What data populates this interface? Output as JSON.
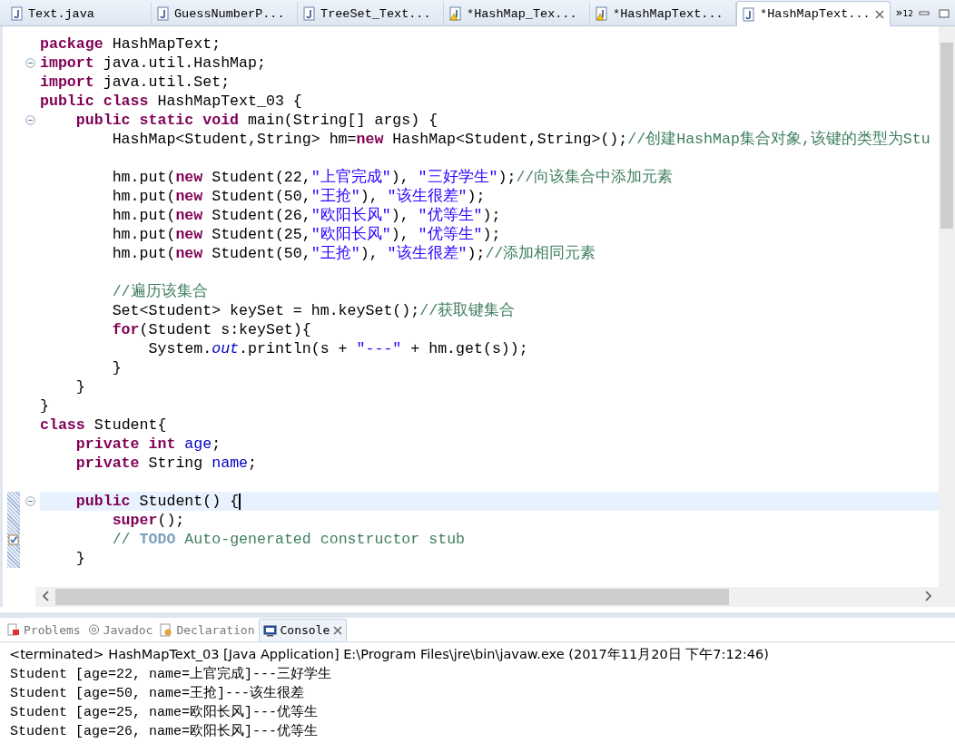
{
  "editor_tabs": [
    {
      "label": "Text.java",
      "selected": false,
      "warning": false
    },
    {
      "label": "GuessNumberP...",
      "selected": false,
      "warning": false
    },
    {
      "label": "TreeSet_Text...",
      "selected": false,
      "warning": false
    },
    {
      "label": "*HashMap_Tex...",
      "selected": false,
      "warning": true
    },
    {
      "label": "*HashMapText...",
      "selected": false,
      "warning": true
    },
    {
      "label": "*HashMapText...",
      "selected": true,
      "warning": false
    }
  ],
  "overflow_tabs": {
    "label": "»",
    "count": "12"
  },
  "code_lines": [
    {
      "kind": "code",
      "tokens": [
        {
          "kind": "kw",
          "text": "package"
        },
        {
          "kind": "plain",
          "text": " HashMapText;"
        }
      ]
    },
    {
      "kind": "code",
      "folding": true,
      "tokens": [
        {
          "kind": "kw",
          "text": "import"
        },
        {
          "kind": "plain",
          "text": " java.util.HashMap;"
        }
      ]
    },
    {
      "kind": "code",
      "tokens": [
        {
          "kind": "kw",
          "text": "import"
        },
        {
          "kind": "plain",
          "text": " java.util.Set;"
        }
      ]
    },
    {
      "kind": "code",
      "tokens": [
        {
          "kind": "kw",
          "text": "public class"
        },
        {
          "kind": "plain",
          "text": " HashMapText_03 {"
        }
      ]
    },
    {
      "kind": "code",
      "folding": true,
      "tokens": [
        {
          "kind": "kw",
          "text": "    public static void"
        },
        {
          "kind": "plain",
          "text": " main(String[] args) {"
        }
      ]
    },
    {
      "kind": "code",
      "tokens": [
        {
          "kind": "plain",
          "text": "        HashMap<Student,String> hm="
        },
        {
          "kind": "kw",
          "text": "new"
        },
        {
          "kind": "plain",
          "text": " HashMap<Student,String>();"
        },
        {
          "kind": "comment",
          "text": "//创建HashMap集合对象,该键的类型为Stu"
        }
      ]
    },
    {
      "kind": "blank"
    },
    {
      "kind": "code",
      "tokens": [
        {
          "kind": "plain",
          "text": "        hm.put("
        },
        {
          "kind": "kw",
          "text": "new"
        },
        {
          "kind": "plain",
          "text": " Student(22,"
        },
        {
          "kind": "str",
          "text": "\"上官完成\""
        },
        {
          "kind": "plain",
          "text": "), "
        },
        {
          "kind": "str",
          "text": "\"三好学生\""
        },
        {
          "kind": "plain",
          "text": ");"
        },
        {
          "kind": "comment",
          "text": "//向该集合中添加元素"
        }
      ]
    },
    {
      "kind": "code",
      "tokens": [
        {
          "kind": "plain",
          "text": "        hm.put("
        },
        {
          "kind": "kw",
          "text": "new"
        },
        {
          "kind": "plain",
          "text": " Student(50,"
        },
        {
          "kind": "str",
          "text": "\"王抢\""
        },
        {
          "kind": "plain",
          "text": "), "
        },
        {
          "kind": "str",
          "text": "\"该生很差\""
        },
        {
          "kind": "plain",
          "text": ");"
        }
      ]
    },
    {
      "kind": "code",
      "tokens": [
        {
          "kind": "plain",
          "text": "        hm.put("
        },
        {
          "kind": "kw",
          "text": "new"
        },
        {
          "kind": "plain",
          "text": " Student(26,"
        },
        {
          "kind": "str",
          "text": "\"欧阳长风\""
        },
        {
          "kind": "plain",
          "text": "), "
        },
        {
          "kind": "str",
          "text": "\"优等生\""
        },
        {
          "kind": "plain",
          "text": ");"
        }
      ]
    },
    {
      "kind": "code",
      "tokens": [
        {
          "kind": "plain",
          "text": "        hm.put("
        },
        {
          "kind": "kw",
          "text": "new"
        },
        {
          "kind": "plain",
          "text": " Student(25,"
        },
        {
          "kind": "str",
          "text": "\"欧阳长风\""
        },
        {
          "kind": "plain",
          "text": "), "
        },
        {
          "kind": "str",
          "text": "\"优等生\""
        },
        {
          "kind": "plain",
          "text": ");"
        }
      ]
    },
    {
      "kind": "code",
      "tokens": [
        {
          "kind": "plain",
          "text": "        hm.put("
        },
        {
          "kind": "kw",
          "text": "new"
        },
        {
          "kind": "plain",
          "text": " Student(50,"
        },
        {
          "kind": "str",
          "text": "\"王抢\""
        },
        {
          "kind": "plain",
          "text": "), "
        },
        {
          "kind": "str",
          "text": "\"该生很差\""
        },
        {
          "kind": "plain",
          "text": ");"
        },
        {
          "kind": "comment",
          "text": "//添加相同元素"
        }
      ]
    },
    {
      "kind": "blank"
    },
    {
      "kind": "code",
      "tokens": [
        {
          "kind": "comment",
          "text": "        //遍历该集合"
        }
      ]
    },
    {
      "kind": "code",
      "tokens": [
        {
          "kind": "plain",
          "text": "        Set<Student> keySet = hm.keySet();"
        },
        {
          "kind": "comment",
          "text": "//获取键集合"
        }
      ]
    },
    {
      "kind": "code",
      "tokens": [
        {
          "kind": "kw",
          "text": "        for"
        },
        {
          "kind": "plain",
          "text": "(Student s:keySet){"
        }
      ]
    },
    {
      "kind": "code",
      "tokens": [
        {
          "kind": "plain",
          "text": "            System."
        },
        {
          "kind": "static",
          "text": "out"
        },
        {
          "kind": "plain",
          "text": ".println(s + "
        },
        {
          "kind": "str",
          "text": "\"---\""
        },
        {
          "kind": "plain",
          "text": " + hm.get(s));"
        }
      ]
    },
    {
      "kind": "code",
      "tokens": [
        {
          "kind": "plain",
          "text": "        }"
        }
      ]
    },
    {
      "kind": "code",
      "tokens": [
        {
          "kind": "plain",
          "text": "    }"
        }
      ]
    },
    {
      "kind": "code",
      "tokens": [
        {
          "kind": "plain",
          "text": "}"
        }
      ]
    },
    {
      "kind": "code",
      "tokens": [
        {
          "kind": "kw",
          "text": "class"
        },
        {
          "kind": "plain",
          "text": " Student{"
        }
      ]
    },
    {
      "kind": "code",
      "tokens": [
        {
          "kind": "kw",
          "text": "    private int "
        },
        {
          "kind": "field",
          "text": "age"
        },
        {
          "kind": "plain",
          "text": ";"
        }
      ]
    },
    {
      "kind": "code",
      "tokens": [
        {
          "kind": "kw",
          "text": "    private"
        },
        {
          "kind": "plain",
          "text": " String "
        },
        {
          "kind": "field",
          "text": "name"
        },
        {
          "kind": "plain",
          "text": ";"
        }
      ]
    },
    {
      "kind": "blank"
    },
    {
      "kind": "code",
      "folding": true,
      "current": true,
      "changed": true,
      "tokens": [
        {
          "kind": "kw",
          "text": "    public"
        },
        {
          "kind": "plain",
          "text": " Student() {"
        }
      ]
    },
    {
      "kind": "code",
      "changed": true,
      "tokens": [
        {
          "kind": "kw",
          "text": "        super"
        },
        {
          "kind": "plain",
          "text": "();"
        }
      ]
    },
    {
      "kind": "code",
      "changed": true,
      "task": true,
      "tokens": [
        {
          "kind": "comment",
          "text": "        // "
        },
        {
          "kind": "todo",
          "text": "TODO"
        },
        {
          "kind": "comment",
          "text": " Auto-generated constructor stub"
        }
      ]
    },
    {
      "kind": "code",
      "changed": true,
      "tokens": [
        {
          "kind": "plain",
          "text": "    }"
        }
      ]
    },
    {
      "kind": "blank"
    }
  ],
  "panel_tabs": [
    {
      "label": "Problems",
      "selected": false
    },
    {
      "label": "Javadoc",
      "selected": false
    },
    {
      "label": "Declaration",
      "selected": false
    },
    {
      "label": "Console",
      "selected": true
    }
  ],
  "console": {
    "header": "<terminated> HashMapText_03 [Java Application] E:\\Program Files\\jre\\bin\\javaw.exe (2017年11月20日 下午7:12:46)",
    "output": [
      "Student [age=22, name=上官完成]---三好学生",
      "Student [age=50, name=王抢]---该生很差",
      "Student [age=25, name=欧阳长风]---优等生",
      "Student [age=26, name=欧阳长风]---优等生"
    ]
  }
}
